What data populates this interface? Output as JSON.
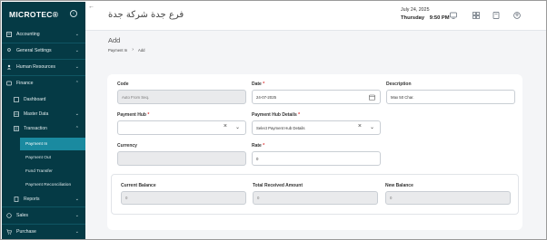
{
  "sidebar": {
    "logo": "MICROTEC®",
    "items": [
      {
        "label": "Accounting"
      },
      {
        "label": "General Settings"
      },
      {
        "label": "Human Resources"
      },
      {
        "label": "Finance"
      }
    ],
    "finance_children": [
      {
        "label": "Dashboard"
      },
      {
        "label": "Master Data"
      },
      {
        "label": "Transaction"
      }
    ],
    "transaction_children": [
      {
        "label": "Payment In"
      },
      {
        "label": "Payment Out"
      },
      {
        "label": "Fund Transfer"
      },
      {
        "label": "Payment Reconciliation"
      }
    ],
    "reports": {
      "label": "Reports"
    },
    "bottom_items": [
      {
        "label": "Sales"
      },
      {
        "label": "Purchase"
      }
    ]
  },
  "header": {
    "company_name": "فرع جدة شركة جدة",
    "date": "July 24, 2025",
    "day": "Thursday",
    "time": "9:50 PM"
  },
  "page": {
    "title": "Add",
    "breadcrumb": [
      "Payment In",
      "Add"
    ]
  },
  "form": {
    "code": {
      "label": "Code",
      "value": "Auto From Seq."
    },
    "date": {
      "label": "Date",
      "value": "24-07-2025"
    },
    "description": {
      "label": "Description",
      "value": "Max 50 Char."
    },
    "payment_hub": {
      "label": "Payment Hub",
      "value": ""
    },
    "payment_hub_details": {
      "label": "Payment Hub Details",
      "value": "Select Payment Hub Details"
    },
    "currency": {
      "label": "Currency",
      "value": ""
    },
    "rate": {
      "label": "Rate",
      "value": "0"
    },
    "required_marker": "*"
  },
  "totals": {
    "current_balance": {
      "label": "Current Balance",
      "value": "0"
    },
    "total_received": {
      "label": "Total Received Amount",
      "value": "0"
    },
    "new_balance": {
      "label": "New Balance",
      "value": "0"
    }
  },
  "colors": {
    "sidebar_bg": "#053a45",
    "active_item": "#1a8aa0",
    "required": "#dd3333"
  }
}
